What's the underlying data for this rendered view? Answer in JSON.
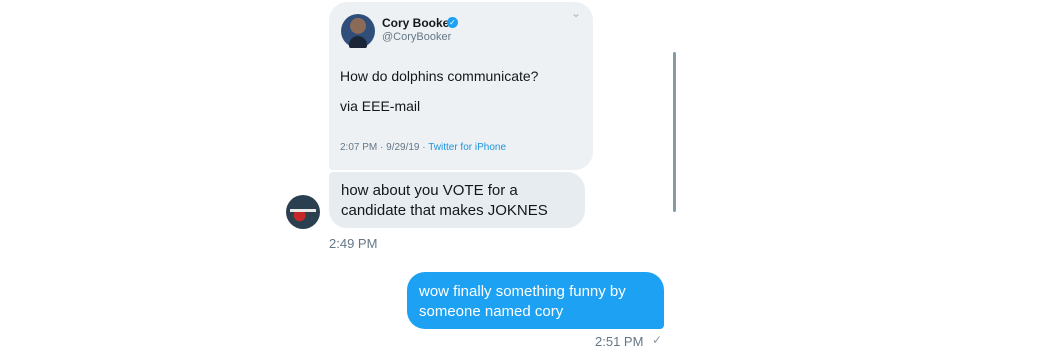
{
  "shared_tweet": {
    "author_name": "Cory Booker",
    "author_handle": "@CoryBooker",
    "text_line1": "How do dolphins communicate?",
    "text_line2": "via EEE-mail",
    "time_date": "2:07 PM · 9/29/19 · ",
    "source": "Twitter for iPhone",
    "chevron_icon": "chevron-down-icon",
    "verified_icon": "verified-badge-icon"
  },
  "received_message": {
    "lines": [
      "how about you VOTE for a",
      "candidate that makes JOKNES"
    ],
    "timestamp": "2:49 PM"
  },
  "sent_message": {
    "lines": [
      "wow finally something funny by",
      "someone named cory"
    ],
    "timestamp": "2:51 PM",
    "status_icon": "checkmark-icon"
  },
  "colors": {
    "accent": "#1da1f2",
    "received_bubble": "#e6ecf0",
    "secondary_text": "#657786"
  }
}
